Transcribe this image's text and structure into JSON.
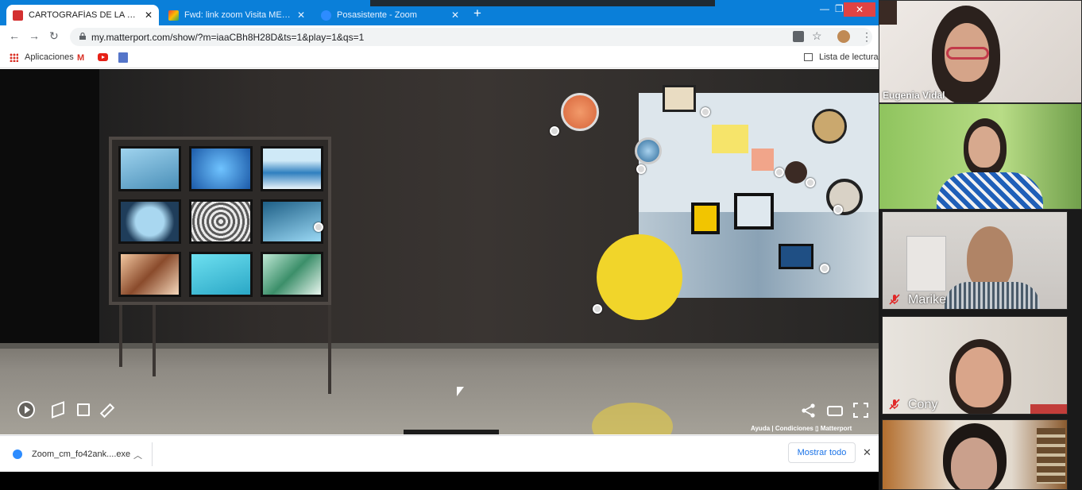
{
  "browser": {
    "tabs": [
      {
        "title": "CARTOGRAFÍAS DE LA SANGRE",
        "favicon": "red-square-icon",
        "color": "#d32f2f",
        "active": true
      },
      {
        "title": "Fwd: link zoom Visita MEdiada -",
        "favicon": "gmail-icon",
        "color": "#ea4335",
        "active": false
      },
      {
        "title": "Posasistente - Zoom",
        "favicon": "zoom-icon",
        "color": "#2d8cff",
        "active": false
      }
    ],
    "url": "my.matterport.com/show/?m=iaaCBh8H28D&ts=1&play=1&qs=1",
    "bookmarks": {
      "apps_label": "Aplicaciones",
      "gmail": "M",
      "reading_list": "Lista de lectura"
    }
  },
  "viewer": {
    "footer": "Ayuda  |  Condiciones  ▯ Matterport",
    "tools": [
      "play-icon",
      "dollhouse-icon",
      "floorplan-icon",
      "measure-icon",
      "share-icon",
      "vr-icon",
      "fullscreen-icon"
    ]
  },
  "downloads": {
    "filename": "Zoom_cm_fo42ank....exe",
    "show_all": "Mostrar todo"
  },
  "zoom": {
    "participants": [
      {
        "name": "Eugenia Vidal",
        "muted": false
      },
      {
        "name": "",
        "muted": false
      },
      {
        "name": "Marike",
        "muted": true
      },
      {
        "name": "Cony",
        "muted": true
      },
      {
        "name": "",
        "muted": false
      }
    ]
  }
}
